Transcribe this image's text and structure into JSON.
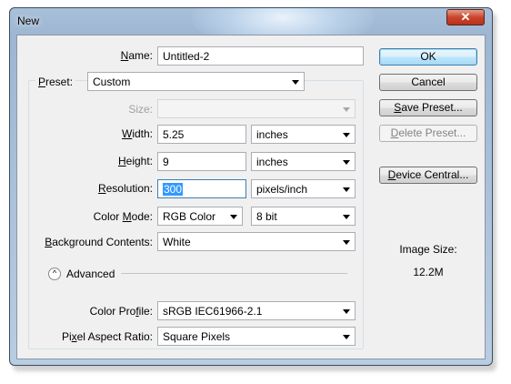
{
  "window": {
    "title": "New",
    "close_glyph": "✕"
  },
  "form": {
    "name_label": "Name:",
    "name_value": "Untitled-2",
    "preset_label": "Preset:",
    "preset_value": "Custom",
    "size_label": "Size:",
    "size_value": "",
    "width_label": "Width:",
    "width_value": "5.25",
    "width_unit": "inches",
    "height_label": "Height:",
    "height_value": "9",
    "height_unit": "inches",
    "resolution_label": "Resolution:",
    "resolution_value": "300",
    "resolution_unit": "pixels/inch",
    "color_mode_label": "Color Mode:",
    "color_mode_value": "RGB Color",
    "bit_depth_value": "8 bit",
    "background_label": "Background Contents:",
    "background_value": "White",
    "advanced_label": "Advanced",
    "advanced_icon": "^",
    "color_profile_label": "Color Profile:",
    "color_profile_value": "sRGB IEC61966-2.1",
    "pixel_aspect_label": "Pixel Aspect Ratio:",
    "pixel_aspect_value": "Square Pixels"
  },
  "buttons": {
    "ok": "OK",
    "cancel": "Cancel",
    "save_preset": "Save Preset...",
    "delete_preset": "Delete Preset...",
    "device_central": "Device Central..."
  },
  "image_size": {
    "label": "Image Size:",
    "value": "12.2M"
  }
}
